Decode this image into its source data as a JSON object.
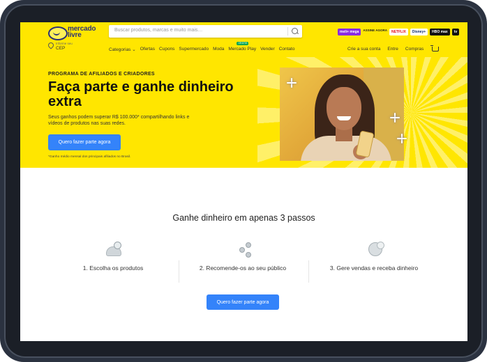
{
  "brand": {
    "logo_line1": "mercado",
    "logo_line2": "livre"
  },
  "search": {
    "placeholder": "Buscar produtos, marcas e muito mais…"
  },
  "promos": {
    "meli": "meli+ mega",
    "assine": "ASSINE AGORA",
    "netflix": "NETFLIX",
    "disney": "Disney+",
    "hbo": "HBO max",
    "appletv": "tv"
  },
  "location": {
    "prompt": "Informe seu",
    "label": "CEP"
  },
  "nav": {
    "items": [
      "Categorias",
      "Ofertas",
      "Cupons",
      "Supermercado",
      "Moda",
      "Mercado Play",
      "Vender",
      "Contato"
    ],
    "play_badge": "GRÁTIS"
  },
  "user_nav": {
    "create": "Crie a sua conta",
    "login": "Entre",
    "purchases": "Compras"
  },
  "hero": {
    "eyebrow": "PROGRAMA DE AFILIADOS E CRIADORES",
    "headline": "Faça parte e ganhe dinheiro extra",
    "subtitle": "Seus ganhos podem superar R$ 100.000* compartilhando links e vídeos de produtos nas suas redes.",
    "cta": "Quero fazer parte agora",
    "footnote": "*Ganho médio mensal dos principais afiliados no Brasil."
  },
  "steps": {
    "title": "Ganhe dinheiro em apenas 3 passos",
    "items": [
      {
        "label": "1. Escolha os produtos",
        "icon": "sneaker-icon"
      },
      {
        "label": "2. Recomende-os ao seu público",
        "icon": "share-icon"
      },
      {
        "label": "3. Gere vendas e receba dinheiro",
        "icon": "coins-icon"
      }
    ],
    "cta": "Quero fazer parte agora"
  },
  "colors": {
    "brand_yellow": "#ffe600",
    "accent_blue": "#3483fa",
    "logo_navy": "#2d3277"
  }
}
